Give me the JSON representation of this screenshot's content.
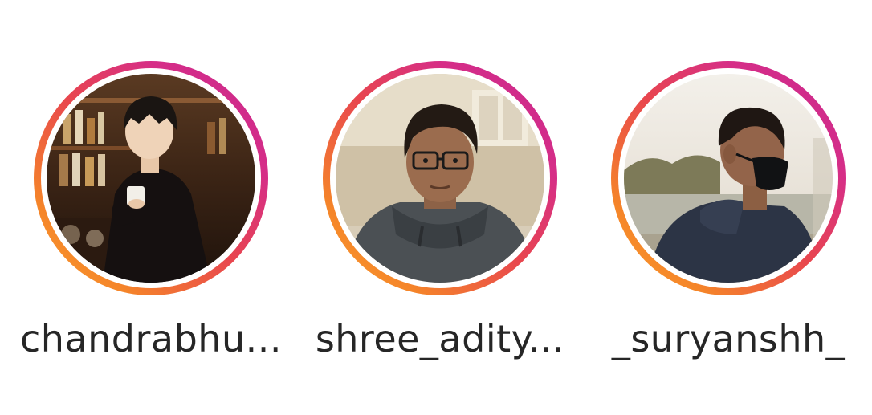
{
  "stories": [
    {
      "username": "chandrabhu...",
      "avatar": "anime-bartender-avatar"
    },
    {
      "username": "shree_adity...",
      "avatar": "glasses-hoodie-selfie-avatar"
    },
    {
      "username": "_suryanshh_",
      "avatar": "masked-outdoor-profile-avatar"
    }
  ],
  "colors": {
    "ring_start": "#f9a131",
    "ring_end": "#c82790",
    "text": "#262626"
  }
}
